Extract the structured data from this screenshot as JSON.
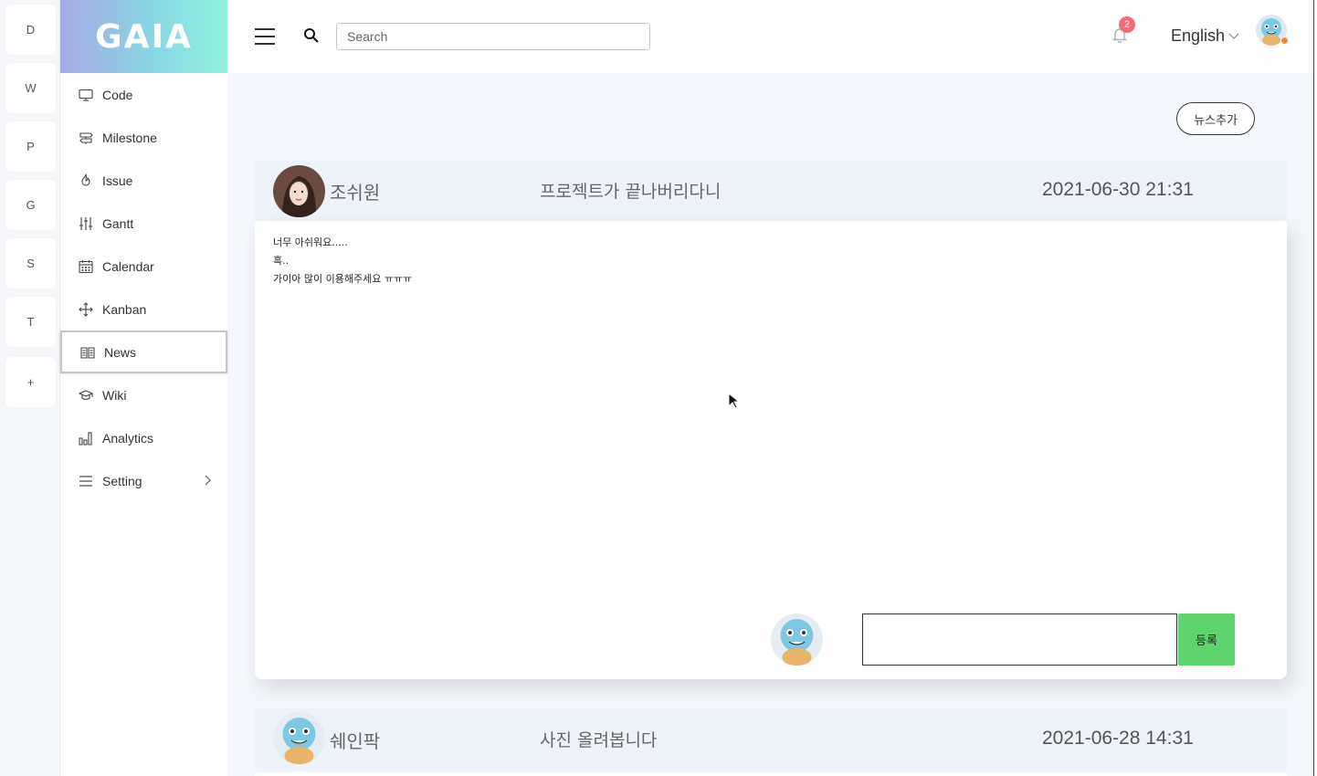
{
  "projects": [
    "D",
    "W",
    "P",
    "G",
    "S",
    "T",
    "+"
  ],
  "logo": "GAIA",
  "menu": [
    {
      "label": "Code",
      "icon": "monitor-icon"
    },
    {
      "label": "Milestone",
      "icon": "signpost-icon"
    },
    {
      "label": "Issue",
      "icon": "fire-icon"
    },
    {
      "label": "Gantt",
      "icon": "sliders-icon"
    },
    {
      "label": "Calendar",
      "icon": "calendar-icon"
    },
    {
      "label": "Kanban",
      "icon": "move-icon"
    },
    {
      "label": "News",
      "icon": "book-icon",
      "active": true
    },
    {
      "label": "Wiki",
      "icon": "graduation-cap-icon"
    },
    {
      "label": "Analytics",
      "icon": "bar-chart-icon"
    },
    {
      "label": "Setting",
      "icon": "menu-lines-icon"
    }
  ],
  "topbar": {
    "search_placeholder": "Search",
    "notification_count": "2",
    "language": "English"
  },
  "main": {
    "add_news_label": "뉴스추가",
    "posts": [
      {
        "author": "조쉬원",
        "title": "프로젝트가 끝나버리다니",
        "date": "2021-06-30 21:31",
        "body_lines": [
          "너무 아쉬워요.....",
          "흑..",
          "가이아 많이 이용해주세요 ㅠㅠㅠ"
        ],
        "comment_placeholder": "",
        "comment_submit_label": "등록"
      },
      {
        "author": "쉐인팍",
        "title": "사진 올려봅니다",
        "date": "2021-06-28 14:31"
      }
    ]
  },
  "colors": {
    "accent_green": "#5fd46c",
    "badge_red": "#f36a78",
    "header_bg": "#eef3fa",
    "logo_gradient_start": "#a7a9e6",
    "logo_gradient_end": "#8ff2dc"
  }
}
